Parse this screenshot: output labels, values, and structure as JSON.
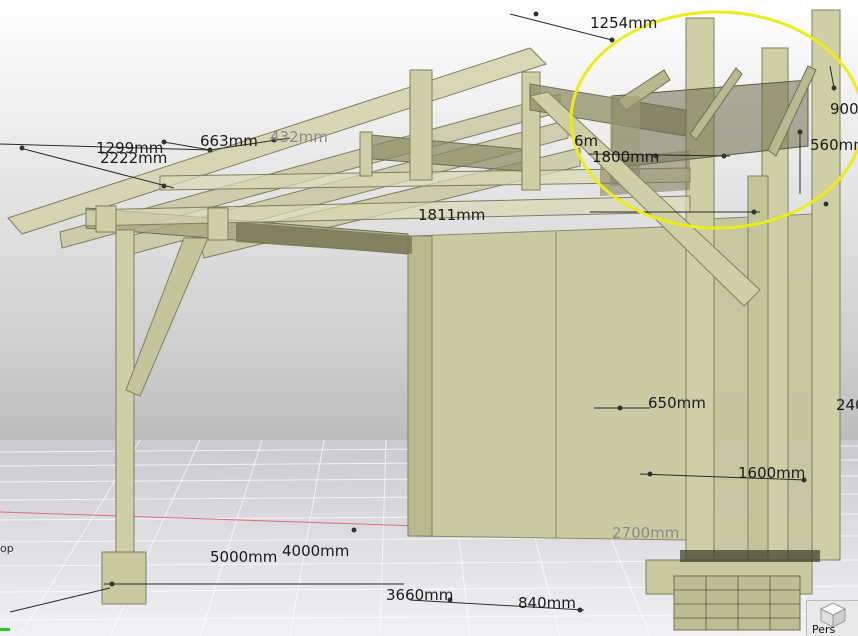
{
  "viewport": {
    "projection_label": "Pers",
    "axis_label": "op"
  },
  "dimensions": {
    "d1254": "1254mm",
    "d1299": "1299mm",
    "d2222": "2222mm",
    "d663": "663mm",
    "d432": "432mm",
    "d1800": "1800mm",
    "d6m": "6m",
    "d900": "900",
    "d560": "560mm",
    "d1811": "1811mm",
    "d650": "650mm",
    "d240": "240",
    "d1600": "1600mm",
    "d2700": "2700mm",
    "d5000": "5000mm",
    "d4000": "4000mm",
    "d3660": "3660mm",
    "d840": "840mm"
  },
  "colors": {
    "wood": "#c9c9a0",
    "wood_dark": "#8a8a63",
    "highlight": "#ecec1a"
  }
}
